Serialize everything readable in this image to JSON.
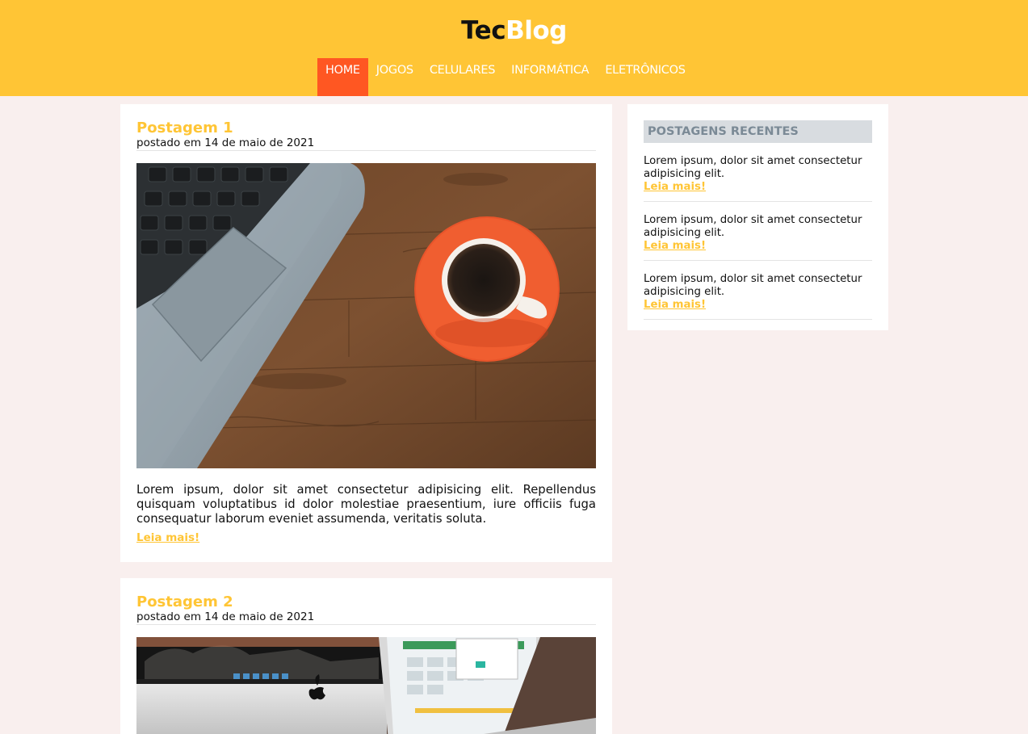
{
  "header": {
    "logo_part1": "Tec",
    "logo_part2": "Blog",
    "nav": [
      {
        "label": "HOME",
        "active": true
      },
      {
        "label": "JOGOS"
      },
      {
        "label": "CELULARES"
      },
      {
        "label": "INFORMÁTICA"
      },
      {
        "label": "ELETRÔNICOS"
      }
    ]
  },
  "posts": [
    {
      "title": "Postagem 1",
      "date": "postado em 14 de maio de 2021",
      "image": "laptop-and-coffee-cup-photo",
      "text": "Lorem ipsum, dolor sit amet consectetur adipisicing elit. Repellendus quisquam voluptatibus id dolor molestiae praesentium, iure officiis fuga consequatur laborum eveniet assumenda, veritatis soluta.",
      "read_more": "Leia mais!"
    },
    {
      "title": "Postagem 2",
      "date": "postado em 14 de maio de 2021",
      "image": "imac-and-macbook-photo"
    }
  ],
  "sidebar": {
    "title": "POSTAGENS RECENTES",
    "items": [
      {
        "text": "Lorem ipsum, dolor sit amet consectetur adipisicing elit.",
        "link": "Leia mais!"
      },
      {
        "text": "Lorem ipsum, dolor sit amet consectetur adipisicing elit.",
        "link": "Leia mais!"
      },
      {
        "text": "Lorem ipsum, dolor sit amet consectetur adipisicing elit.",
        "link": "Leia mais!"
      }
    ]
  },
  "colors": {
    "header_bg": "#ffc535",
    "nav_active": "#ff5722",
    "page_bg": "#f9efee"
  }
}
